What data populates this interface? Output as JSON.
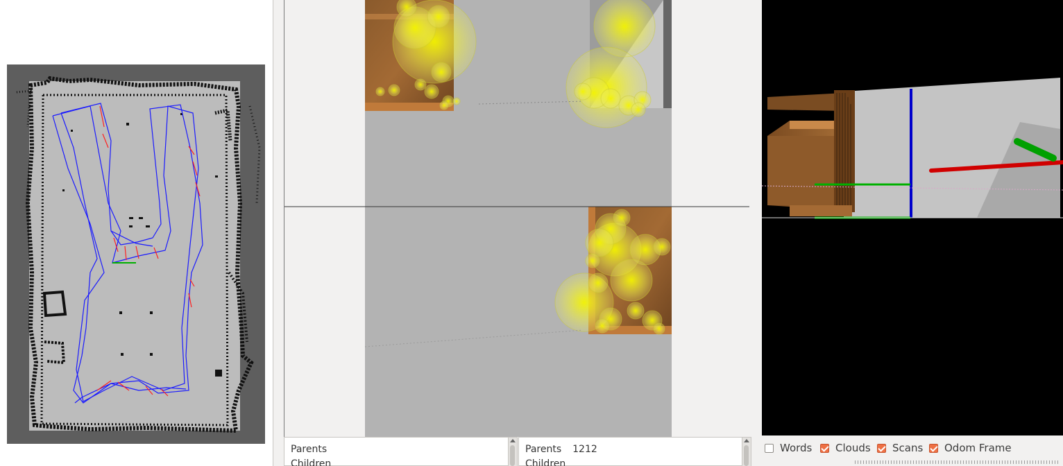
{
  "app": {
    "panels": [
      "map-view",
      "stereo-view",
      "scene-3d"
    ]
  },
  "info_left": {
    "parents_label": "Parents",
    "parents_value": "",
    "children_label": "Children"
  },
  "info_right": {
    "parents_label": "Parents",
    "parents_value": "1212",
    "children_label": "Children"
  },
  "view_options": {
    "items": [
      {
        "label": "Words",
        "checked": false
      },
      {
        "label": "Clouds",
        "checked": true
      },
      {
        "label": "Scans",
        "checked": true
      },
      {
        "label": "Odom Frame",
        "checked": true
      }
    ]
  },
  "colors": {
    "checkbox_checked": "#ee7044",
    "graph_links": "#1a1aff",
    "loop_closure_links": "#ff2020",
    "feature_markers": "#f0f000",
    "axis_x": "#d00000",
    "axis_y": "#00b000",
    "axis_z": "#0000cc",
    "map_background": "#5e5e5e",
    "map_free_space": "#bcbcbc"
  },
  "icons": {
    "checkbox": "checkbox-icon",
    "scroll_up": "scroll-up-arrow-icon"
  }
}
